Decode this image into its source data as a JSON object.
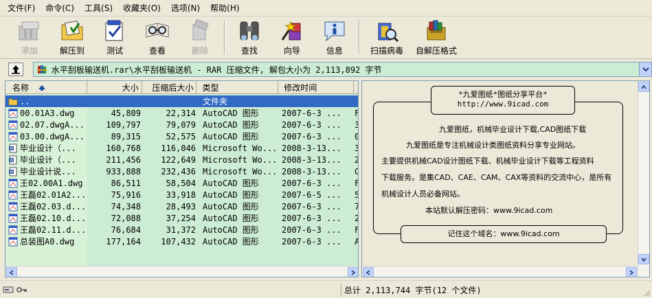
{
  "menu": [
    {
      "label": "文件(F)"
    },
    {
      "label": "命令(C)"
    },
    {
      "label": "工具(S)"
    },
    {
      "label": "收藏夹(O)"
    },
    {
      "label": "选项(N)"
    },
    {
      "label": "帮助(H)"
    }
  ],
  "toolbar": {
    "add": "添加",
    "extract_to": "解压到",
    "test": "测试",
    "view": "查看",
    "delete": "删除",
    "find": "查找",
    "wizard": "向导",
    "info": "信息",
    "virus_scan": "扫描病毒",
    "sfx": "自解压格式"
  },
  "address": {
    "path": "水平刮板输送机.rar\\水平刮板输送机 - RAR 压缩文件, 解包大小为 2,113,892 字节"
  },
  "columns": {
    "name": "名称",
    "size": "大小",
    "packed": "压缩后大小",
    "type": "类型",
    "mtime": "修改时间"
  },
  "rows": [
    {
      "name": "..",
      "size": "",
      "packed": "",
      "type": "文件夹",
      "mtime": "",
      "crc": "",
      "icon": "folder"
    },
    {
      "name": "00.01A3.dwg",
      "size": "45,809",
      "packed": "22,314",
      "type": "AutoCAD 图形",
      "mtime": "2007-6-3 ...",
      "crc": "F",
      "icon": "dwg"
    },
    {
      "name": "02.07.dwgA...",
      "size": "109,797",
      "packed": "79,079",
      "type": "AutoCAD 图形",
      "mtime": "2007-6-3 ...",
      "crc": "3",
      "icon": "dwg"
    },
    {
      "name": "03.00.dwgA...",
      "size": "89,315",
      "packed": "52,575",
      "type": "AutoCAD 图形",
      "mtime": "2007-6-3 ...",
      "crc": "0",
      "icon": "dwg"
    },
    {
      "name": "毕业设计（...",
      "size": "160,768",
      "packed": "116,046",
      "type": "Microsoft Wo...",
      "mtime": "2008-3-13...",
      "crc": "3",
      "icon": "doc"
    },
    {
      "name": "毕业设计（...",
      "size": "211,456",
      "packed": "122,649",
      "type": "Microsoft Wo...",
      "mtime": "2008-3-13...",
      "crc": "2",
      "icon": "doc"
    },
    {
      "name": "毕业设计说...",
      "size": "933,888",
      "packed": "232,436",
      "type": "Microsoft Wo...",
      "mtime": "2008-3-13...",
      "crc": "C",
      "icon": "doc"
    },
    {
      "name": "王02.00A1.dwg",
      "size": "86,511",
      "packed": "58,504",
      "type": "AutoCAD 图形",
      "mtime": "2007-6-3 ...",
      "crc": "F",
      "icon": "dwg"
    },
    {
      "name": "王磊02.01A2...",
      "size": "75,916",
      "packed": "33,918",
      "type": "AutoCAD 图形",
      "mtime": "2007-6-5 ...",
      "crc": "5",
      "icon": "dwg"
    },
    {
      "name": "王磊02.03.d...",
      "size": "74,348",
      "packed": "28,493",
      "type": "AutoCAD 图形",
      "mtime": "2007-6-3 ...",
      "crc": "7",
      "icon": "dwg"
    },
    {
      "name": "王磊02.10.d...",
      "size": "72,088",
      "packed": "37,254",
      "type": "AutoCAD 图形",
      "mtime": "2007-6-3 ...",
      "crc": "2",
      "icon": "dwg"
    },
    {
      "name": "王磊02.11.d...",
      "size": "76,684",
      "packed": "31,372",
      "type": "AutoCAD 图形",
      "mtime": "2007-6-3 ...",
      "crc": "F",
      "icon": "dwg"
    },
    {
      "name": "总装图A0.dwg",
      "size": "177,164",
      "packed": "107,432",
      "type": "AutoCAD 图形",
      "mtime": "2007-6-3 ...",
      "crc": "A",
      "icon": "dwg"
    }
  ],
  "comment": {
    "title": "*九爱图纸*图纸分享平台*",
    "url": "http://www.9icad.com",
    "line1": "九爱图纸，机械毕业设计下载,CAD图纸下载",
    "line2": "九爱图纸是专注机械设计类图纸资料分享专业网站。",
    "line3": "主要提供机械CAD设计图纸下载、机械毕业设计下载等工程资料",
    "line4": "下载服务。是集CAD、CAE、CAM、CAX等资料的交流中心，是所有",
    "line5": "机械设计人员必备网站。",
    "line6": "本站默认解压密码：www.9icad.com",
    "footer": "记住这个域名：www.9icad.com"
  },
  "status": {
    "total": "总计 2,113,744 字节(12 个文件)"
  },
  "colors": {
    "list_bg": "#ccecd4",
    "selection": "#316ac5",
    "chrome": "#ece9d8"
  }
}
